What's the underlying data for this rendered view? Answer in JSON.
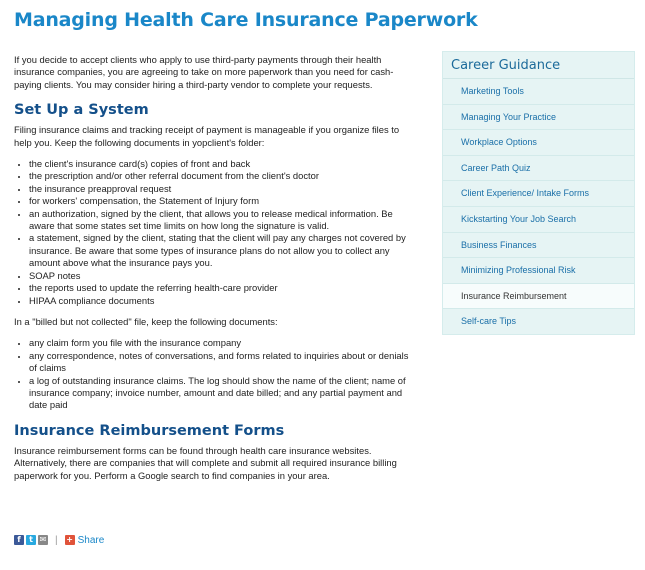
{
  "title": "Managing Health Care Insurance Paperwork",
  "intro": "If you decide to accept clients who apply to use third-party payments through their health insurance companies, you are agreeing to take on more paperwork than you need for cash-paying clients. You may consider hiring a third-party vendor to complete your requests.",
  "section1": {
    "heading": "Set Up a System",
    "lead": "Filing insurance claims and tracking receipt of payment is manageable if you organize files to help you. Keep the following documents in yopclient's folder:",
    "items": [
      "the client's insurance card(s) copies of front and back",
      "the prescription and/or other referral document from the client's doctor",
      "the insurance preapproval request",
      "for workers' compensation, the Statement of Injury form",
      "an authorization, signed by the client, that allows you to release medical information. Be aware that some states set time limits on how long the signature is valid.",
      "a statement, signed by the client, stating that the client will pay any charges not covered by insurance. Be aware that some types of insurance plans do not allow you to collect any amount above what the insurance pays you.",
      "SOAP notes",
      "the reports used to update the referring health-care provider",
      "HIPAA compliance documents"
    ],
    "lead2": "In a \"billed but not collected\" file, keep the following documents:",
    "items2": [
      "any claim form you file with the insurance company",
      "any correspondence, notes of conversations, and forms related to inquiries about or denials of claims",
      "a log of outstanding insurance claims. The log should show the name of the client; name of insurance company; invoice number, amount and date billed; and any partial payment and date paid"
    ]
  },
  "section2": {
    "heading": "Insurance Reimbursement Forms",
    "body": "Insurance reimbursement forms can be found through health care insurance websites. Alternatively, there are companies that will complete and submit all required insurance billing paperwork for you. Perform a Google search to find companies in your area."
  },
  "share": {
    "label": "Share",
    "icons": [
      "facebook-icon",
      "twitter-icon",
      "email-icon",
      "plus-icon"
    ]
  },
  "sidebar": {
    "heading": "Career Guidance",
    "items": [
      {
        "label": "Marketing Tools",
        "active": false
      },
      {
        "label": "Managing Your Practice",
        "active": false
      },
      {
        "label": "Workplace Options",
        "active": false
      },
      {
        "label": "Career Path Quiz",
        "active": false
      },
      {
        "label": "Client Experience/ Intake Forms",
        "active": false
      },
      {
        "label": "Kickstarting Your Job Search",
        "active": false
      },
      {
        "label": "Business Finances",
        "active": false
      },
      {
        "label": "Minimizing Professional Risk",
        "active": false
      },
      {
        "label": "Insurance Reimbursement",
        "active": true
      },
      {
        "label": "Self-care Tips",
        "active": false
      }
    ]
  },
  "colors": {
    "title": "#1a87c8",
    "heading": "#14508a",
    "link": "#1a6fa8",
    "sidebar_bg": "#e6f4f4"
  }
}
